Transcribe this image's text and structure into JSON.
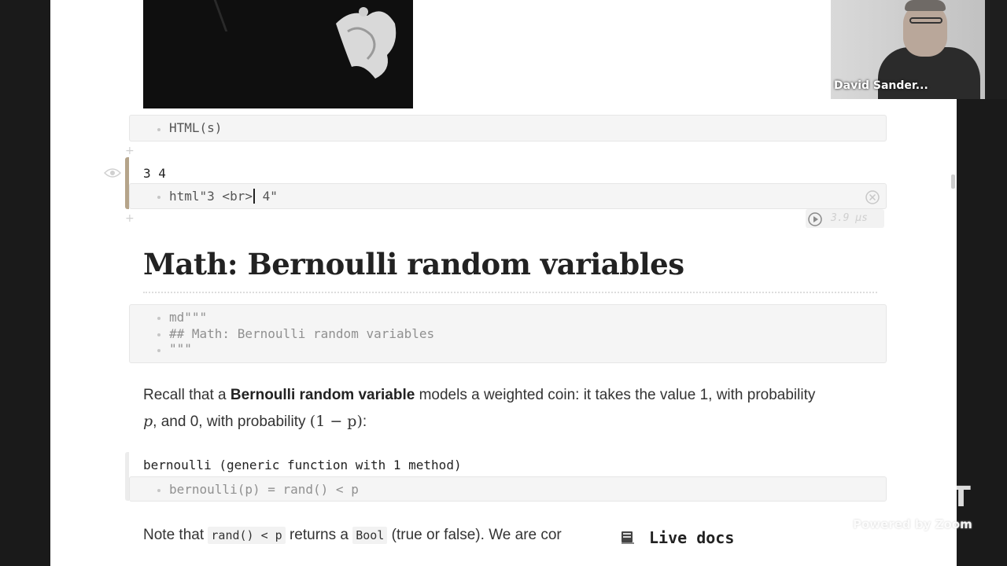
{
  "cells": {
    "html_s": {
      "code": "HTML(s)"
    },
    "html_br": {
      "output": "3 4",
      "code_before_cursor": "html\"3 <br>",
      "code_after_cursor": " 4\"",
      "runtime": "3.9 μs"
    },
    "md_cell": {
      "lines": [
        "md\"\"\"",
        "## Math: Bernoulli random variables",
        "\"\"\""
      ]
    },
    "bernoulli": {
      "output": "bernoulli (generic function with 1 method)",
      "code": "bernoulli(p) = rand() < p"
    }
  },
  "heading": "Math: Bernoulli random variables",
  "paragraph1": {
    "line1_prefix": "Recall that a ",
    "line1_bold": "Bernoulli random variable",
    "line1_suffix": " models a weighted coin: it takes the value 1, with probability",
    "line2_p": "p",
    "line2_mid": ", and 0, with probability ",
    "line2_math": "(1 − p)",
    "line2_end": ":"
  },
  "paragraph2": {
    "prefix": "Note that ",
    "code1": "rand() < p",
    "mid": " returns a ",
    "code2": "Bool",
    "suffix": " (true or false). We are cor"
  },
  "live_docs": {
    "label": "Live docs",
    "icon": "book-icon"
  },
  "video": {
    "participant_name": "David Sander..."
  },
  "watermark": {
    "logo": "MIT",
    "powered_by": "Powered by Zoom"
  },
  "colors": {
    "active_cell_border": "#b5a48a",
    "cell_bg": "#f5f5f5"
  }
}
